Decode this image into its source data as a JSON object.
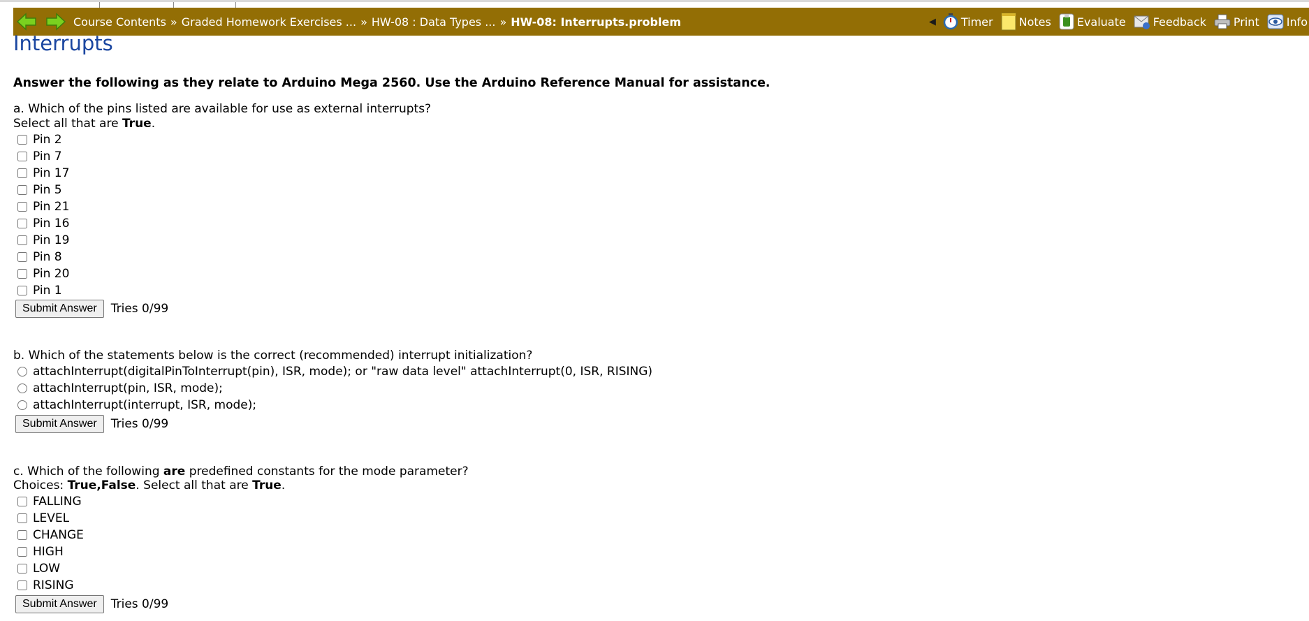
{
  "nav": {
    "breadcrumbs": [
      "Course Contents",
      "Graded Homework Exercises ...",
      "HW-08 : Data Types ...",
      "HW-08: Interrupts.problem"
    ],
    "separator": "»",
    "tools": [
      {
        "label": "Timer",
        "icon": "stopwatch-icon"
      },
      {
        "label": "Notes",
        "icon": "notepad-icon"
      },
      {
        "label": "Evaluate",
        "icon": "evaluate-icon"
      },
      {
        "label": "Feedback",
        "icon": "feedback-icon"
      },
      {
        "label": "Print",
        "icon": "printer-icon"
      },
      {
        "label": "Info",
        "icon": "eye-info-icon"
      }
    ],
    "colors": {
      "bar": "#936e05",
      "arrow": "#6cc417"
    }
  },
  "page": {
    "title": "Interrupts",
    "intro": "Answer the following as they relate to Arduino Mega 2560. Use the Arduino Reference Manual for assistance."
  },
  "qa": {
    "prompt": "a. Which of the pins listed are available for use as external interrupts?",
    "instruction_prefix": "Select all that are ",
    "instruction_bold": "True",
    "instruction_suffix": ".",
    "options": [
      "Pin 2",
      "Pin 7",
      "Pin 17",
      "Pin 5",
      "Pin 21",
      "Pin 16",
      "Pin 19",
      "Pin 8",
      "Pin 20",
      "Pin 1"
    ],
    "submit": "Submit Answer",
    "tries": "Tries 0/99"
  },
  "qb": {
    "prompt": "b. Which of the statements below is the correct (recommended) interrupt initialization?",
    "options": [
      "attachInterrupt(digitalPinToInterrupt(pin), ISR, mode); or \"raw data level\" attachInterrupt(0, ISR, RISING)",
      "attachInterrupt(pin, ISR, mode);",
      "attachInterrupt(interrupt, ISR, mode);"
    ],
    "submit": "Submit Answer",
    "tries": "Tries 0/99"
  },
  "qc": {
    "prompt_prefix": "c. Which of the following ",
    "prompt_bold": "are",
    "prompt_suffix": " predefined constants for the mode parameter?",
    "choices_prefix": "Choices: ",
    "choices_bold": "True,False",
    "choices_mid": ". Select all that are ",
    "choices_bold2": "True",
    "choices_suffix": ".",
    "options": [
      "FALLING",
      "LEVEL",
      "CHANGE",
      "HIGH",
      "LOW",
      "RISING"
    ],
    "submit": "Submit Answer",
    "tries": "Tries 0/99"
  }
}
